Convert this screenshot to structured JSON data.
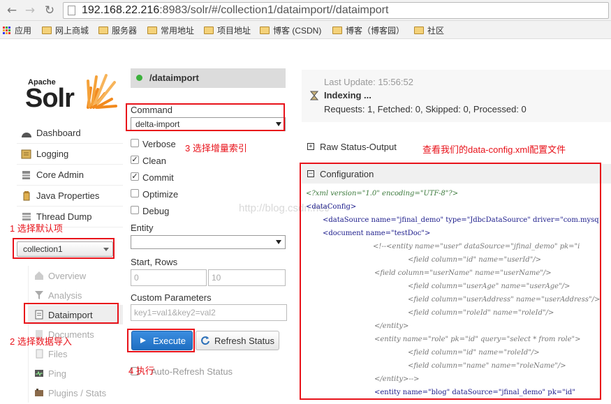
{
  "browser": {
    "url_prefix": "192.168.22.216",
    "url_rest": ":8983/solr/#/collection1/dataimport//dataimport",
    "bookmarks": [
      "应用",
      "网上商城",
      "服务器",
      "常用地址",
      "项目地址",
      "博客 (CSDN)",
      "博客（博客园）",
      "社区"
    ]
  },
  "logo": {
    "apache": "Apache",
    "solr": "Solr"
  },
  "sidebar": {
    "items": [
      {
        "label": "Dashboard"
      },
      {
        "label": "Logging"
      },
      {
        "label": "Core Admin"
      },
      {
        "label": "Java Properties"
      },
      {
        "label": "Thread Dump"
      }
    ],
    "core_selected": "collection1",
    "core_items": [
      {
        "label": "Overview"
      },
      {
        "label": "Analysis"
      },
      {
        "label": "Dataimport"
      },
      {
        "label": "Documents"
      },
      {
        "label": "Files"
      },
      {
        "label": "Ping"
      },
      {
        "label": "Plugins / Stats"
      }
    ]
  },
  "dataimport": {
    "title": "/dataimport",
    "command_label": "Command",
    "command_value": "delta-import",
    "options": [
      {
        "label": "Verbose",
        "checked": false
      },
      {
        "label": "Clean",
        "checked": true
      },
      {
        "label": "Commit",
        "checked": true
      },
      {
        "label": "Optimize",
        "checked": false
      },
      {
        "label": "Debug",
        "checked": false
      }
    ],
    "entity_label": "Entity",
    "start_rows_label": "Start, Rows",
    "start_value": "0",
    "rows_value": "10",
    "custom_params_label": "Custom Parameters",
    "custom_params_placeholder": "key1=val1&key2=val2",
    "execute_label": "Execute",
    "refresh_label": "Refresh Status",
    "auto_refresh_label": "Auto-Refresh Status"
  },
  "status": {
    "last_update": "Last Update: 15:56:52",
    "state": "Indexing ...",
    "counts": "Requests: 1, Fetched: 0, Skipped: 0, Processed: 0"
  },
  "sections": {
    "raw": "Raw Status-Output",
    "config": "Configuration"
  },
  "annotations": {
    "a1": "1 选择默认项",
    "a2": "2 选择数据导入",
    "a3": "3 选择增量索引",
    "a4": "4 执行",
    "a5": "查看我们的data-config.xml配置文件"
  },
  "watermark": "http://blog.csdn.net/",
  "xml_lines": [
    "<?xml version=\"1.0\" encoding=\"UTF-8\"?>",
    "<dataConfig>",
    "<dataSource name=\"jfinal_demo\" type=\"JdbcDataSource\" driver=\"com.mysq",
    "<document name=\"testDoc\">",
    "<!--<entity name=\"user\" dataSource=\"jfinal_demo\" pk=\"i",
    "<field column=\"id\" name=\"userId\"/>",
    "<field column=\"userName\" name=\"userName\"/>",
    "<field column=\"userAge\" name=\"userAge\"/>",
    "<field column=\"userAddress\" name=\"userAddress\"/>",
    "<field column=\"roleId\" name=\"roleId\"/>",
    "</entity>",
    "<entity name=\"role\" pk=\"id\" query=\"select * from role\">",
    "<field column=\"id\" name=\"roleId\"/>",
    "<field column=\"name\" name=\"roleName\"/>",
    "</entity>-->",
    "<entity name=\"blog\" dataSource=\"jfinal_demo\" pk=\"id\""
  ]
}
